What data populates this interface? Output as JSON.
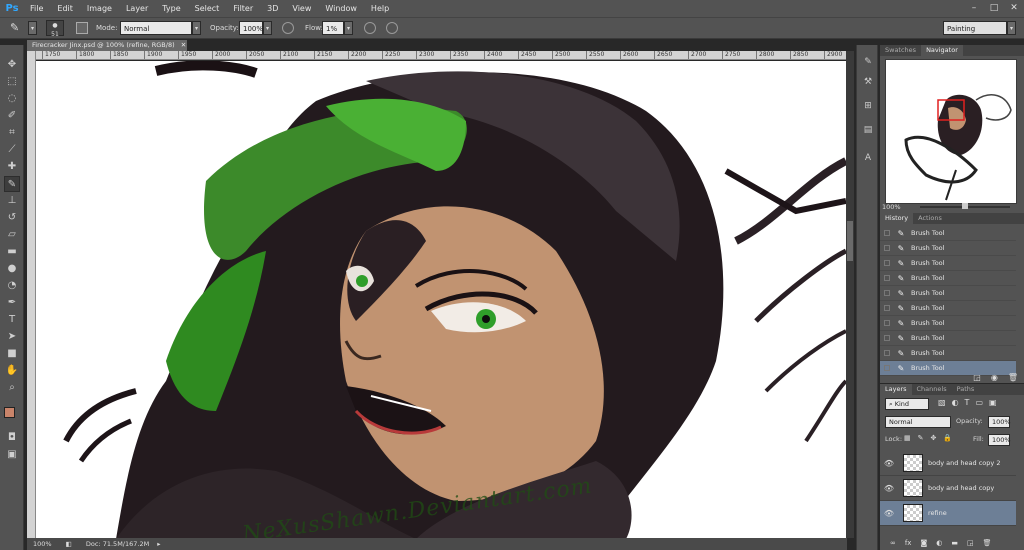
{
  "app": {
    "logo": "Ps"
  },
  "menu": [
    "File",
    "Edit",
    "Image",
    "Layer",
    "Type",
    "Select",
    "Filter",
    "3D",
    "View",
    "Window",
    "Help"
  ],
  "window_controls": [
    "–",
    "□",
    "✕"
  ],
  "options": {
    "brush_size": "51",
    "mode_label": "Mode:",
    "mode_value": "Normal",
    "opacity_label": "Opacity:",
    "opacity_value": "100%",
    "flow_label": "Flow:",
    "flow_value": "1%",
    "workspace": "Painting"
  },
  "document": {
    "tab_title": "Firecracker Jinx.psd @ 100% (refine, RGB/8)",
    "ruler_ticks": [
      "1750",
      "1800",
      "1850",
      "1900",
      "1950",
      "2000",
      "2050",
      "2100",
      "2150",
      "2200",
      "2250",
      "2300",
      "2350",
      "2400",
      "2450",
      "2500",
      "2550",
      "2600",
      "2650",
      "2700",
      "2750",
      "2800",
      "2850",
      "2900"
    ],
    "zoom": "100%",
    "doc_info": "Doc: 71.5M/167.2M",
    "watermark": "NeXusShawn.Deviantart.com"
  },
  "navigator": {
    "tabs": [
      "Swatches",
      "Navigator"
    ],
    "zoom": "100%"
  },
  "history": {
    "tabs": [
      "History",
      "Actions"
    ],
    "items": [
      "Brush Tool",
      "Brush Tool",
      "Brush Tool",
      "Brush Tool",
      "Brush Tool",
      "Brush Tool",
      "Brush Tool",
      "Brush Tool",
      "Brush Tool",
      "Brush Tool"
    ],
    "selected_index": 9
  },
  "layers": {
    "tabs": [
      "Layers",
      "Channels",
      "Paths"
    ],
    "filter_kind": "Kind",
    "blend_mode": "Normal",
    "opacity_label": "Opacity:",
    "opacity_value": "100%",
    "lock_label": "Lock:",
    "fill_label": "Fill:",
    "fill_value": "100%",
    "items": [
      "body and head copy 2",
      "body and head copy",
      "refine"
    ],
    "selected_index": 2
  },
  "colors": {
    "foreground": "#c9846a",
    "background": "#ffffff",
    "accent_select": "#6d7f96"
  }
}
